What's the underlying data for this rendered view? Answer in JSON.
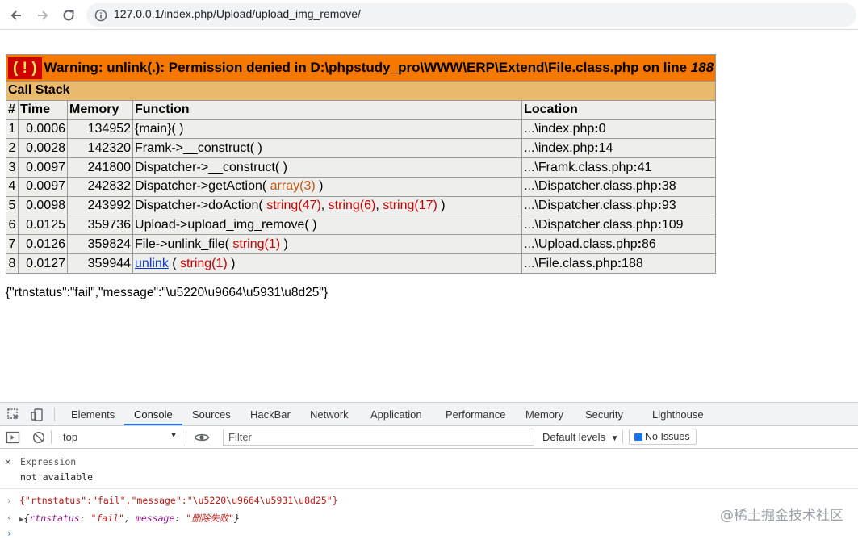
{
  "browser": {
    "url": "127.0.0.1/index.php/Upload/upload_img_remove/"
  },
  "xdebug": {
    "badge": "( ! )",
    "warning_text": "Warning: unlink(.): Permission denied in D:\\phpstudy_pro\\WWW\\ERP\\Extend\\File.class.php on line",
    "warning_line": "188",
    "call_stack_title": "Call Stack",
    "headers": [
      "#",
      "Time",
      "Memory",
      "Function",
      "Location"
    ],
    "rows": [
      {
        "idx": "1",
        "time": "0.0006",
        "memory": "134952",
        "func": "{main}( )",
        "args": [],
        "close": "",
        "loc": "...\\index.php",
        "line": "0"
      },
      {
        "idx": "2",
        "time": "0.0028",
        "memory": "142320",
        "func": "Framk->__construct( )",
        "args": [],
        "close": "",
        "loc": "...\\index.php",
        "line": "14"
      },
      {
        "idx": "3",
        "time": "0.0097",
        "memory": "241800",
        "func": "Dispatcher->__construct( )",
        "args": [],
        "close": "",
        "loc": "...\\Framk.class.php",
        "line": "41"
      },
      {
        "idx": "4",
        "time": "0.0097",
        "memory": "242832",
        "func": "Dispatcher->getAction( ",
        "args": [
          {
            "text": "array(3)",
            "color": "orange"
          }
        ],
        "close": " )",
        "loc": "...\\Dispatcher.class.php",
        "line": "38"
      },
      {
        "idx": "5",
        "time": "0.0098",
        "memory": "243992",
        "func": "Dispatcher->doAction( ",
        "args": [
          {
            "text": "string(47)",
            "color": "red"
          },
          {
            "text": "string(6)",
            "color": "red"
          },
          {
            "text": "string(17)",
            "color": "red"
          }
        ],
        "close": " )",
        "loc": "...\\Dispatcher.class.php",
        "line": "93"
      },
      {
        "idx": "6",
        "time": "0.0125",
        "memory": "359736",
        "func": "Upload->upload_img_remove( )",
        "args": [],
        "close": "",
        "loc": "...\\Dispatcher.class.php",
        "line": "109"
      },
      {
        "idx": "7",
        "time": "0.0126",
        "memory": "359824",
        "func": "File->unlink_file( ",
        "args": [
          {
            "text": "string(1)",
            "color": "red"
          }
        ],
        "close": " )",
        "loc": "...\\Upload.class.php",
        "line": "86"
      },
      {
        "idx": "8",
        "time": "0.0127",
        "memory": "359944",
        "func_link": "unlink",
        "func": " ( ",
        "args": [
          {
            "text": "string(1)",
            "color": "red"
          }
        ],
        "close": " )",
        "loc": "...\\File.class.php",
        "line": "188"
      }
    ],
    "json_output": "{\"rtnstatus\":\"fail\",\"message\":\"\\u5220\\u9664\\u5931\\u8d25\"}"
  },
  "devtools": {
    "tabs": [
      "Elements",
      "Console",
      "Sources",
      "HackBar",
      "Network",
      "Application",
      "Performance",
      "Memory",
      "Security",
      "Lighthouse"
    ],
    "active_tab": "Console",
    "context": "top",
    "filter_placeholder": "Filter",
    "levels": "Default levels",
    "issues": "No Issues",
    "live_expression": {
      "label": "Expression",
      "value": "not available"
    },
    "log_string": "{\"rtnstatus\":\"fail\",\"message\":\"\\u5220\\u9664\\u5931\\u8d25\"}",
    "obj_preview": {
      "open": "{",
      "k1": "rtnstatus",
      "v1": "\"fail\"",
      "k2": "message",
      "v2": "\"删除失败\"",
      "close": "}"
    }
  },
  "watermark": "@稀土掘金技术社区"
}
